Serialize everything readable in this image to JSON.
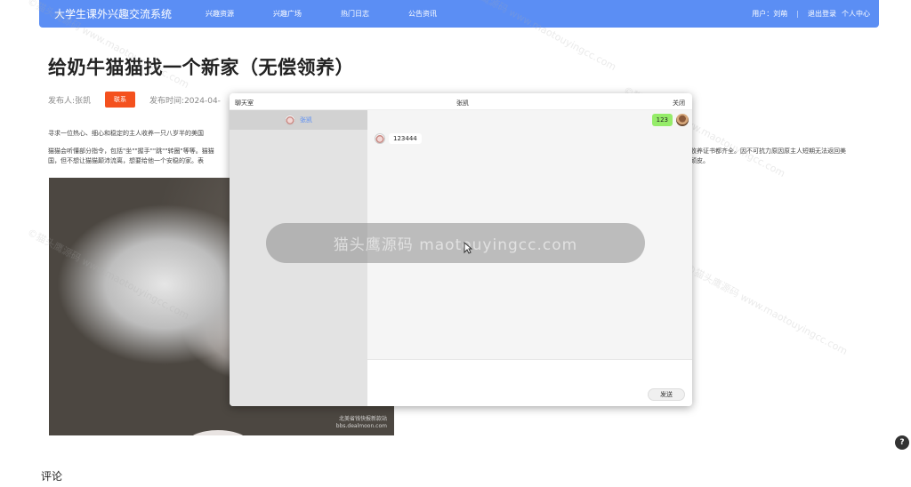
{
  "nav": {
    "brand": "大学生课外兴趣交流系统",
    "items": [
      "兴趣资源",
      "兴趣广场",
      "热门日志",
      "公告资讯"
    ],
    "user_label": "用户：刘萌",
    "logout": "退出登录",
    "profile": "个人中心"
  },
  "article": {
    "title": "给奶牛猫猫找一个新家（无偿领养）",
    "author": "发布人:张凯",
    "contact_btn": "联系",
    "pub_time": "发布时间:2024-04-",
    "para1": "寻求一位热心、细心和稳定的主人收养一只八岁半的美国",
    "para2": "猫猫会听懂部分指令，包括\"坐\"\"握手\"\"跳\"\"转圈\"等等。猫猫",
    "para3": "国，但不想让猫猫颠沛流离，想要给他一个安稳的家。表",
    "para2_tail": "收养证书都齐全。因不可抗力原因原主人短期无法返回美",
    "para3_tail": "顽皮。",
    "photo_watermark_line1": "北美省钱快报新款站",
    "photo_watermark_line2": "bbs.dealmoon.com",
    "comments": "评论"
  },
  "chat": {
    "title_left": "聊天室",
    "title_center": "张凯",
    "close": "关闭",
    "contact_name": "张凯",
    "msg_sent": "123",
    "msg_received": "123444",
    "send": "发送"
  },
  "overlay": {
    "pill_text": "猫头鹰源码 maotouyingcc.com",
    "watermark_text": "©猫头鹰源码 www.maotouyingcc.com"
  },
  "help_icon_text": "?",
  "colors": {
    "nav_bg": "#5b8ef4",
    "contact_btn": "#f4511e",
    "bubble_sent": "#95ec69"
  }
}
